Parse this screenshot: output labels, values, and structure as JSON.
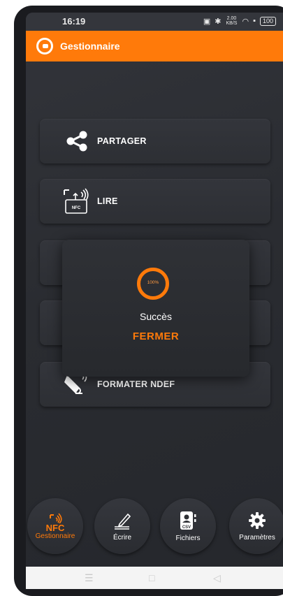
{
  "status_bar": {
    "time": "16:19",
    "network_speed": "2.00 KB/S",
    "battery": "100"
  },
  "app_bar": {
    "title": "Gestionnaire"
  },
  "menu": {
    "share_label": "PARTAGER",
    "read_label": "LIRE",
    "read_icon_text": "NFC",
    "format_label": "FORMATER NDEF"
  },
  "dialog": {
    "progress_text": "100%",
    "progress_value": 100,
    "message": "Succès",
    "close_label": "FERMER"
  },
  "bottom_nav": {
    "home_icon_text": "NFC",
    "home_label": "Gestionnaire",
    "write_label": "Écrire",
    "files_icon_text": "CSV",
    "files_label": "Fichiers",
    "settings_label": "Paramètres"
  },
  "colors": {
    "accent": "#ff7a0a",
    "background": "#2b2d33",
    "text": "#ffffff"
  }
}
